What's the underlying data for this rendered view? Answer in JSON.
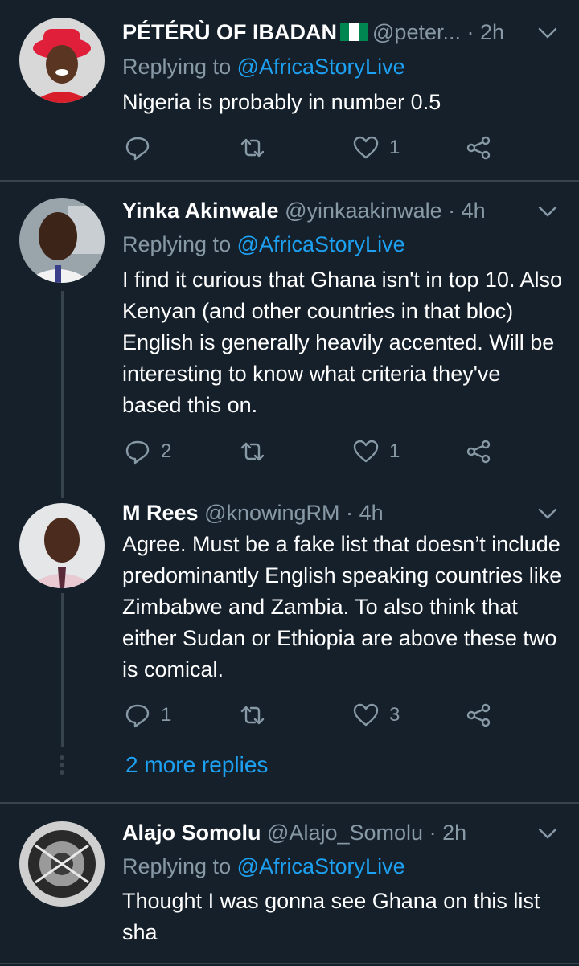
{
  "tweets": [
    {
      "name": "PÉTÉRÙ OF IBADAN",
      "handle": "@peter...",
      "dot": "·",
      "time": "2h",
      "replying_label": "Replying to",
      "replying_to": "@AfricaStoryLive",
      "text": "Nigeria is probably in number 0.5",
      "reply_count": "",
      "retweet_count": "",
      "like_count": "1"
    },
    {
      "name": "Yinka Akinwale",
      "handle": "@yinkaakinwale",
      "dot": "·",
      "time": "4h",
      "replying_label": "Replying to",
      "replying_to": "@AfricaStoryLive",
      "text": "I find it curious that Ghana isn't in top 10. Also Kenyan (and other countries in that bloc) English is generally heavily accented. Will be interesting to know what criteria they've based this on.",
      "reply_count": "2",
      "retweet_count": "",
      "like_count": "1"
    },
    {
      "name": "M Rees",
      "handle": "@knowingRM",
      "dot": "·",
      "time": "4h",
      "text": "Agree. Must be a fake list that doesn’t include predominantly English speaking countries like Zimbabwe and Zambia. To also think that either Sudan or Ethiopia are above these two is comical.",
      "reply_count": "1",
      "retweet_count": "",
      "like_count": "3"
    },
    {
      "name": "Alajo Somolu",
      "handle": "@Alajo_Somolu",
      "dot": "·",
      "time": "2h",
      "replying_label": "Replying to",
      "replying_to": "@AfricaStoryLive",
      "text": "Thought I was gonna see Ghana on this list sha"
    }
  ],
  "more_replies": "2 more replies",
  "colors": {
    "background": "#15202b",
    "muted": "#8899a6",
    "accent": "#1da1f2",
    "divider": "#38444d",
    "nigeria_green": "#008751"
  },
  "icons": [
    "nigeria-flag-icon",
    "chevron-down-icon",
    "reply-icon",
    "retweet-icon",
    "like-icon",
    "share-icon"
  ]
}
